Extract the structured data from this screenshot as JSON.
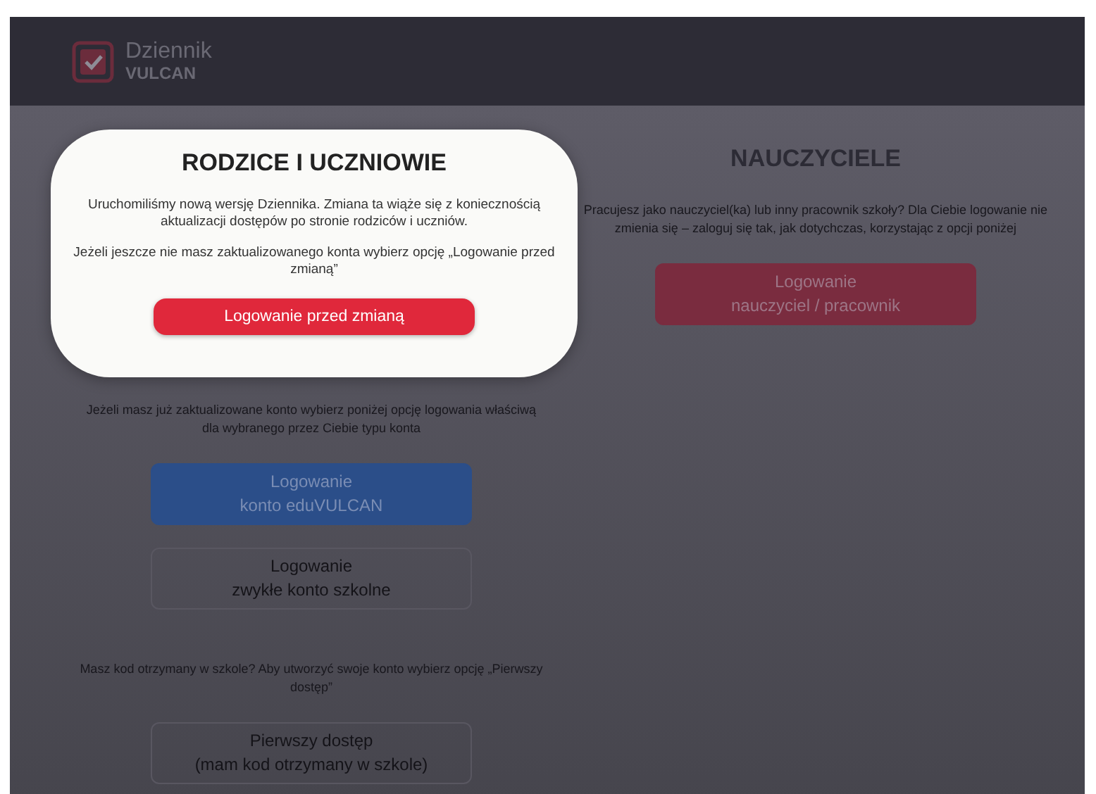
{
  "header": {
    "logo_title": "Dziennik",
    "logo_subtitle": "VULCAN"
  },
  "parents": {
    "sections": [
      {
        "text": "Jeżeli masz już zaktualizowane konto wybierz poniżej opcję logowania właściwą dla wybranego przez Ciebie typu konta",
        "buttons": [
          {
            "kind": "primary",
            "lines": [
              "Logowanie",
              "konto eduVULCAN"
            ]
          },
          {
            "kind": "outline",
            "lines": [
              "Logowanie",
              "zwykłe konto szkolne"
            ]
          }
        ]
      },
      {
        "text": "Masz kod otrzymany w szkole? Aby utworzyć swoje konto wybierz opcję „Pierwszy dostęp”",
        "buttons": [
          {
            "kind": "outline",
            "lines": [
              "Pierwszy dostęp",
              "(mam kod otrzymany w szkole)"
            ]
          }
        ]
      }
    ]
  },
  "teachers": {
    "title": "NAUCZYCIELE",
    "sections": [
      {
        "text": "Pracujesz jako nauczyciel(ka) lub inny pracownik szkoły? Dla Ciebie logowanie nie zmienia się – zaloguj się tak, jak dotychczas, korzystając z opcji poniżej",
        "buttons": [
          {
            "kind": "danger",
            "lines": [
              "Logowanie",
              "nauczyciel / pracownik"
            ]
          }
        ]
      }
    ]
  },
  "dialog": {
    "title": "RODZICE I UCZNIOWIE",
    "paragraphs": [
      "Uruchomiliśmy nową wersję Dziennika. Zmiana ta wiąże się z koniecznością aktualizacji dostępów po stronie rodziców i uczniów.",
      "Jeżeli jeszcze nie masz zaktualizowanego konta wybierz opcję „Logowanie przed zmianą”"
    ],
    "button": "Logowanie przed zmianą"
  }
}
